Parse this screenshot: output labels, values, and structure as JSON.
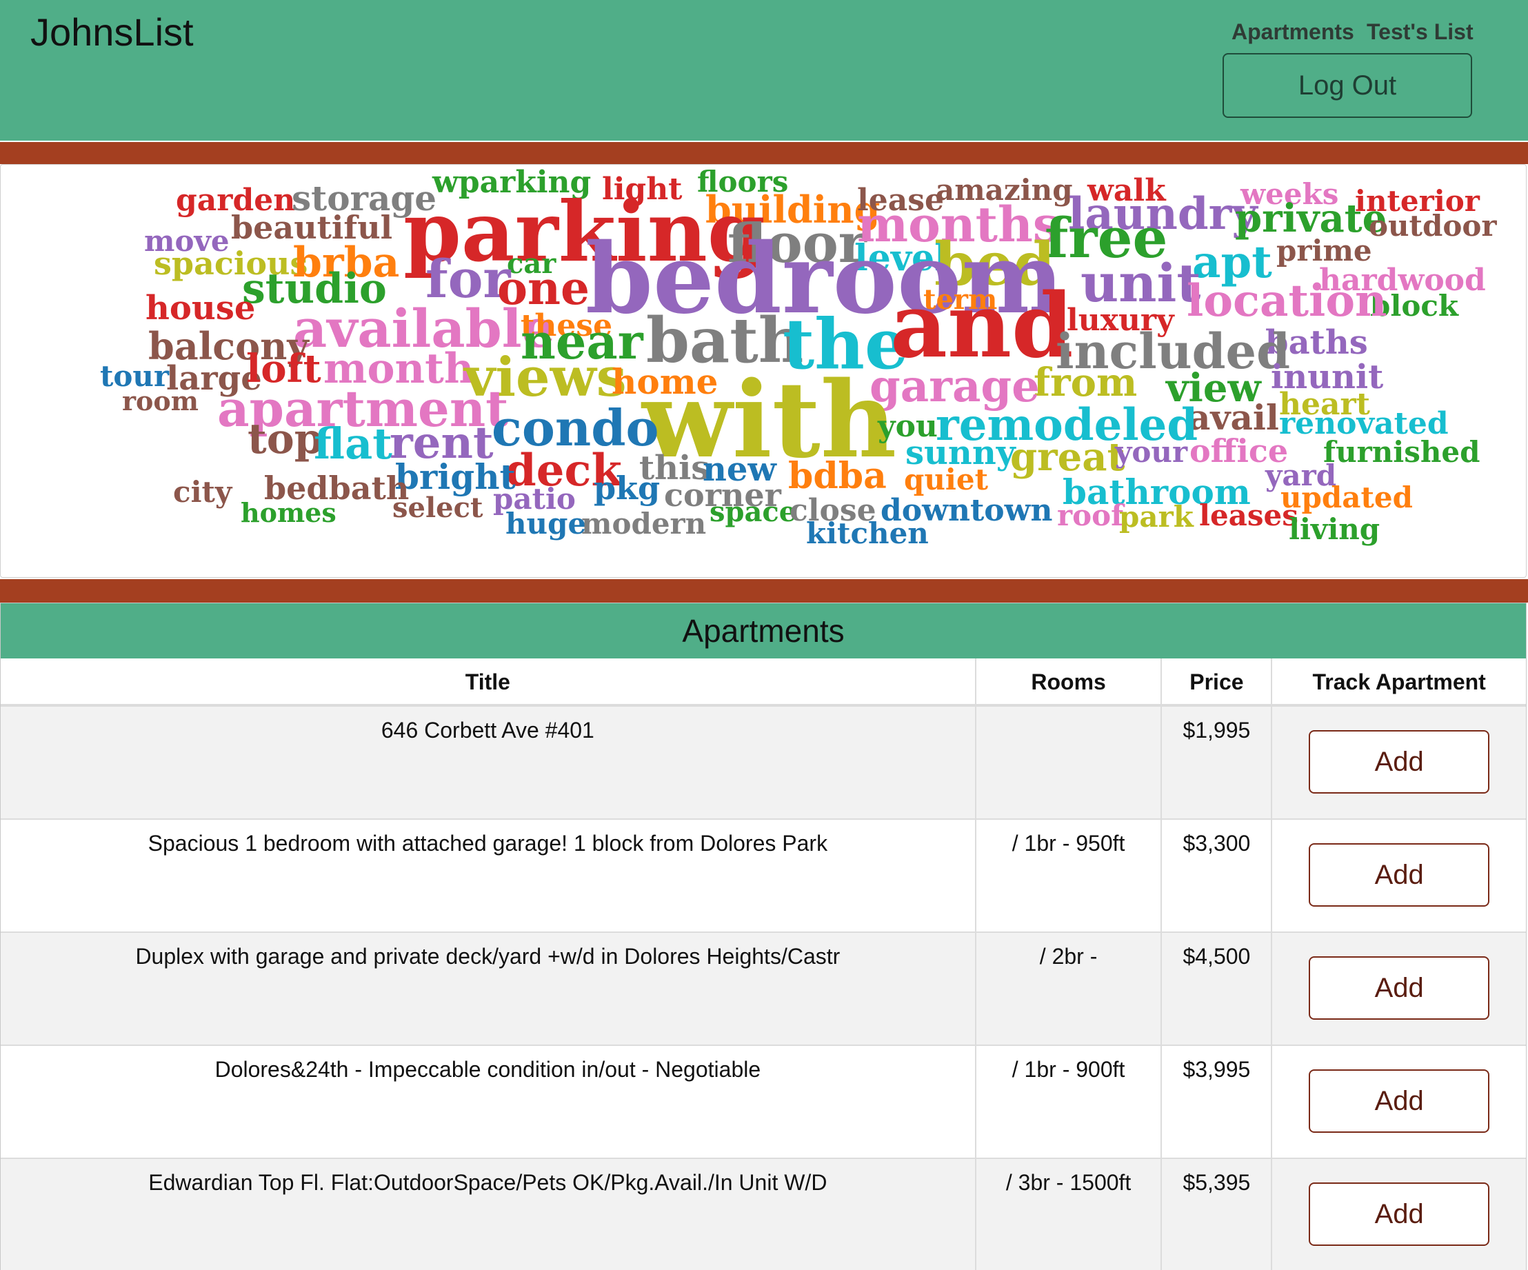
{
  "header": {
    "brand": "JohnsList",
    "nav": [
      "Apartments",
      "Test's List"
    ],
    "logout_label": "Log Out",
    "bg_color": "#50ae88"
  },
  "accent_color": "#a43f20",
  "wordcloud": {
    "words": [
      {
        "text": "garden",
        "color": "#d62728"
      },
      {
        "text": "storage",
        "color": "#7f7f7f"
      },
      {
        "text": "wparking",
        "color": "#2ca02c"
      },
      {
        "text": "light",
        "color": "#d62728"
      },
      {
        "text": "floors",
        "color": "#2ca02c"
      },
      {
        "text": "building",
        "color": "#ff7f0e"
      },
      {
        "text": "lease",
        "color": "#8c564b"
      },
      {
        "text": "amazing",
        "color": "#8c564b"
      },
      {
        "text": "walk",
        "color": "#d62728"
      },
      {
        "text": "weeks",
        "color": "#e377c2"
      },
      {
        "text": "interior",
        "color": "#d62728"
      },
      {
        "text": "move",
        "color": "#9467bd"
      },
      {
        "text": "beautiful",
        "color": "#8c564b"
      },
      {
        "text": "parking",
        "color": "#d62728"
      },
      {
        "text": "floor",
        "color": "#7f7f7f"
      },
      {
        "text": "months",
        "color": "#e377c2"
      },
      {
        "text": "laundry",
        "color": "#9467bd"
      },
      {
        "text": "private",
        "color": "#2ca02c"
      },
      {
        "text": "outdoor",
        "color": "#8c564b"
      },
      {
        "text": "spacious",
        "color": "#bcbd22"
      },
      {
        "text": "brba",
        "color": "#ff7f0e"
      },
      {
        "text": "car",
        "color": "#2ca02c"
      },
      {
        "text": "free",
        "color": "#2ca02c"
      },
      {
        "text": "level",
        "color": "#17becf"
      },
      {
        "text": "apt",
        "color": "#17becf"
      },
      {
        "text": "prime",
        "color": "#8c564b"
      },
      {
        "text": "bed",
        "color": "#bcbd22"
      },
      {
        "text": "hardwood",
        "color": "#e377c2"
      },
      {
        "text": "studio",
        "color": "#2ca02c"
      },
      {
        "text": "for",
        "color": "#9467bd"
      },
      {
        "text": "one",
        "color": "#d62728"
      },
      {
        "text": "bedroom",
        "color": "#9467bd"
      },
      {
        "text": "unit",
        "color": "#9467bd"
      },
      {
        "text": "term",
        "color": "#ff7f0e"
      },
      {
        "text": "block",
        "color": "#2ca02c"
      },
      {
        "text": "house",
        "color": "#d62728"
      },
      {
        "text": "location",
        "color": "#e377c2"
      },
      {
        "text": "available",
        "color": "#e377c2"
      },
      {
        "text": "these",
        "color": "#ff7f0e"
      },
      {
        "text": "luxury",
        "color": "#d62728"
      },
      {
        "text": "balcony",
        "color": "#8c564b"
      },
      {
        "text": "near",
        "color": "#2ca02c"
      },
      {
        "text": "bath",
        "color": "#7f7f7f"
      },
      {
        "text": "the",
        "color": "#17becf"
      },
      {
        "text": "and",
        "color": "#d62728"
      },
      {
        "text": "baths",
        "color": "#9467bd"
      },
      {
        "text": "included",
        "color": "#7f7f7f"
      },
      {
        "text": "tour",
        "color": "#1f77b4"
      },
      {
        "text": "large",
        "color": "#8c564b"
      },
      {
        "text": "loft",
        "color": "#d62728"
      },
      {
        "text": "month",
        "color": "#e377c2"
      },
      {
        "text": "views",
        "color": "#bcbd22"
      },
      {
        "text": "home",
        "color": "#ff7f0e"
      },
      {
        "text": "from",
        "color": "#bcbd22"
      },
      {
        "text": "inunit",
        "color": "#9467bd"
      },
      {
        "text": "room",
        "color": "#8c564b"
      },
      {
        "text": "garage",
        "color": "#e377c2"
      },
      {
        "text": "view",
        "color": "#2ca02c"
      },
      {
        "text": "heart",
        "color": "#bcbd22"
      },
      {
        "text": "apartment",
        "color": "#e377c2"
      },
      {
        "text": "with",
        "color": "#bcbd22"
      },
      {
        "text": "avail",
        "color": "#8c564b"
      },
      {
        "text": "condo",
        "color": "#1f77b4"
      },
      {
        "text": "you",
        "color": "#2ca02c"
      },
      {
        "text": "remodeled",
        "color": "#17becf"
      },
      {
        "text": "renovated",
        "color": "#17becf"
      },
      {
        "text": "top",
        "color": "#8c564b"
      },
      {
        "text": "flat",
        "color": "#17becf"
      },
      {
        "text": "rent",
        "color": "#9467bd"
      },
      {
        "text": "deck",
        "color": "#d62728"
      },
      {
        "text": "sunny",
        "color": "#17becf"
      },
      {
        "text": "office",
        "color": "#e377c2"
      },
      {
        "text": "furnished",
        "color": "#2ca02c"
      },
      {
        "text": "this",
        "color": "#7f7f7f"
      },
      {
        "text": "great",
        "color": "#bcbd22"
      },
      {
        "text": "your",
        "color": "#9467bd"
      },
      {
        "text": "new",
        "color": "#1f77b4"
      },
      {
        "text": "bdba",
        "color": "#ff7f0e"
      },
      {
        "text": "yard",
        "color": "#9467bd"
      },
      {
        "text": "city",
        "color": "#8c564b"
      },
      {
        "text": "bright",
        "color": "#1f77b4"
      },
      {
        "text": "quiet",
        "color": "#ff7f0e"
      },
      {
        "text": "bedbath",
        "color": "#8c564b"
      },
      {
        "text": "pkg",
        "color": "#1f77b4"
      },
      {
        "text": "corner",
        "color": "#7f7f7f"
      },
      {
        "text": "bathroom",
        "color": "#17becf"
      },
      {
        "text": "updated",
        "color": "#ff7f0e"
      },
      {
        "text": "patio",
        "color": "#9467bd"
      },
      {
        "text": "select",
        "color": "#8c564b"
      },
      {
        "text": "homes",
        "color": "#2ca02c"
      },
      {
        "text": "space",
        "color": "#2ca02c"
      },
      {
        "text": "close",
        "color": "#7f7f7f"
      },
      {
        "text": "downtown",
        "color": "#1f77b4"
      },
      {
        "text": "roof",
        "color": "#e377c2"
      },
      {
        "text": "park",
        "color": "#bcbd22"
      },
      {
        "text": "leases",
        "color": "#d62728"
      },
      {
        "text": "huge",
        "color": "#1f77b4"
      },
      {
        "text": "modern",
        "color": "#7f7f7f"
      },
      {
        "text": "living",
        "color": "#2ca02c"
      },
      {
        "text": "kitchen",
        "color": "#1f77b4"
      }
    ]
  },
  "apartments": {
    "title": "Apartments",
    "columns": [
      "Title",
      "Rooms",
      "Price",
      "Track Apartment"
    ],
    "add_label": "Add",
    "rows": [
      {
        "title": "646 Corbett Ave #401",
        "rooms": "",
        "price": "$1,995"
      },
      {
        "title": "Spacious 1 bedroom with attached garage! 1 block from Dolores Park",
        "rooms": "/ 1br - 950ft",
        "price": "$3,300"
      },
      {
        "title": "Duplex with garage and private deck/yard +w/d in Dolores Heights/Castr",
        "rooms": "/ 2br -",
        "price": "$4,500"
      },
      {
        "title": "Dolores&24th - Impeccable condition in/out - Negotiable",
        "rooms": "/ 1br - 900ft",
        "price": "$3,995"
      },
      {
        "title": "Edwardian Top Fl. Flat:OutdoorSpace/Pets OK/Pkg.Avail./In Unit W/D",
        "rooms": "/ 3br - 1500ft",
        "price": "$5,395"
      }
    ]
  }
}
